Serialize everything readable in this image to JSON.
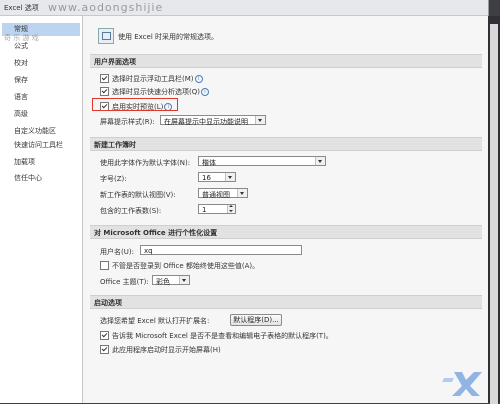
{
  "window": {
    "title": "Excel 选项"
  },
  "watermark": {
    "site": "www.aodongshijie",
    "tagline": "奇 乐 游 戏"
  },
  "sidebar": {
    "items": [
      {
        "label": "常规",
        "active": true
      },
      {
        "label": "公式"
      },
      {
        "label": "校对"
      },
      {
        "label": "保存"
      },
      {
        "label": "语言"
      },
      {
        "label": "高级"
      },
      {
        "label": "自定义功能区"
      },
      {
        "label": "快速访问工具栏"
      },
      {
        "label": "加载项"
      },
      {
        "label": "信任中心"
      }
    ]
  },
  "header": {
    "text": "使用 Excel 时采用的常规选项。"
  },
  "ui_section": {
    "title": "用户界面选项",
    "mini_toolbar": "选择时显示浮动工具栏(M)",
    "quick_analysis": "选择时显示快速分析选项(Q)",
    "live_preview": "启用实时预览(L)",
    "screentip_label": "屏幕提示样式(R):",
    "screentip_value": "在屏幕提示中显示功能说明"
  },
  "new_wb_section": {
    "title": "新建工作簿时",
    "font_label": "使用此字体作为默认字体(N):",
    "font_value": "楷体",
    "size_label": "字号(Z):",
    "size_value": "16",
    "view_label": "新工作表的默认视图(V):",
    "view_value": "普通视图",
    "sheets_label": "包含的工作表数(S):",
    "sheets_value": "1"
  },
  "personalize_section": {
    "title": "对 Microsoft Office 进行个性化设置",
    "username_label": "用户名(U):",
    "username_value": "xq",
    "always_use": "不管是否登录到 Office 都始终使用这些值(A)。",
    "theme_label": "Office 主题(T):",
    "theme_value": "彩色"
  },
  "startup_section": {
    "title": "启动选项",
    "ext_label": "选择您希望 Excel 默认打开扩展名:",
    "default_programs_btn": "默认程序(D)...",
    "tell_me": "告诉我 Microsoft Excel 是否不是查看和编辑电子表格的默认程序(T)。",
    "show_start": "此应用程序启动时显示开始屏幕(H)"
  },
  "colors": {
    "highlight": "#e0392b",
    "sidebar_active": "#bcd4ef"
  }
}
